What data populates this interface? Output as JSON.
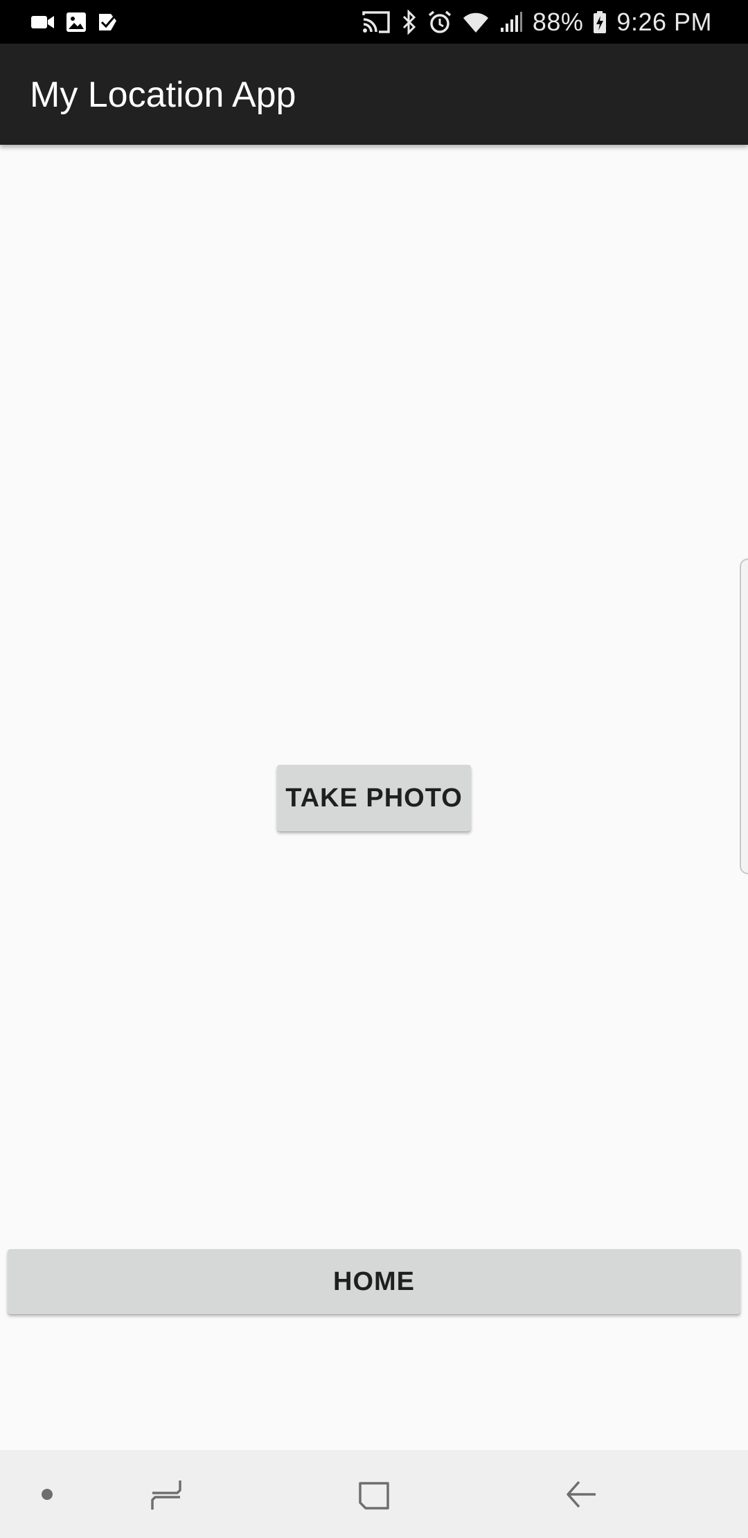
{
  "status_bar": {
    "left_icons": [
      "video-camera-icon",
      "image-icon",
      "check-task-icon"
    ],
    "right_icons": [
      "cast-icon",
      "bluetooth-icon",
      "alarm-icon",
      "wifi-icon",
      "signal-icon"
    ],
    "battery_percent": "88%",
    "time": "9:26 PM"
  },
  "app_bar": {
    "title": "My Location App"
  },
  "main": {
    "take_photo_label": "TAKE PHOTO",
    "home_label": "HOME"
  },
  "nav_bar": {
    "items": [
      "dot-icon",
      "recent-apps-icon",
      "home-icon",
      "back-icon"
    ]
  },
  "colors": {
    "status_bar_bg": "#000000",
    "app_bar_bg": "#212121",
    "background": "#fafafa",
    "button_bg": "#d6d7d7",
    "nav_bar_bg": "#efefef"
  }
}
